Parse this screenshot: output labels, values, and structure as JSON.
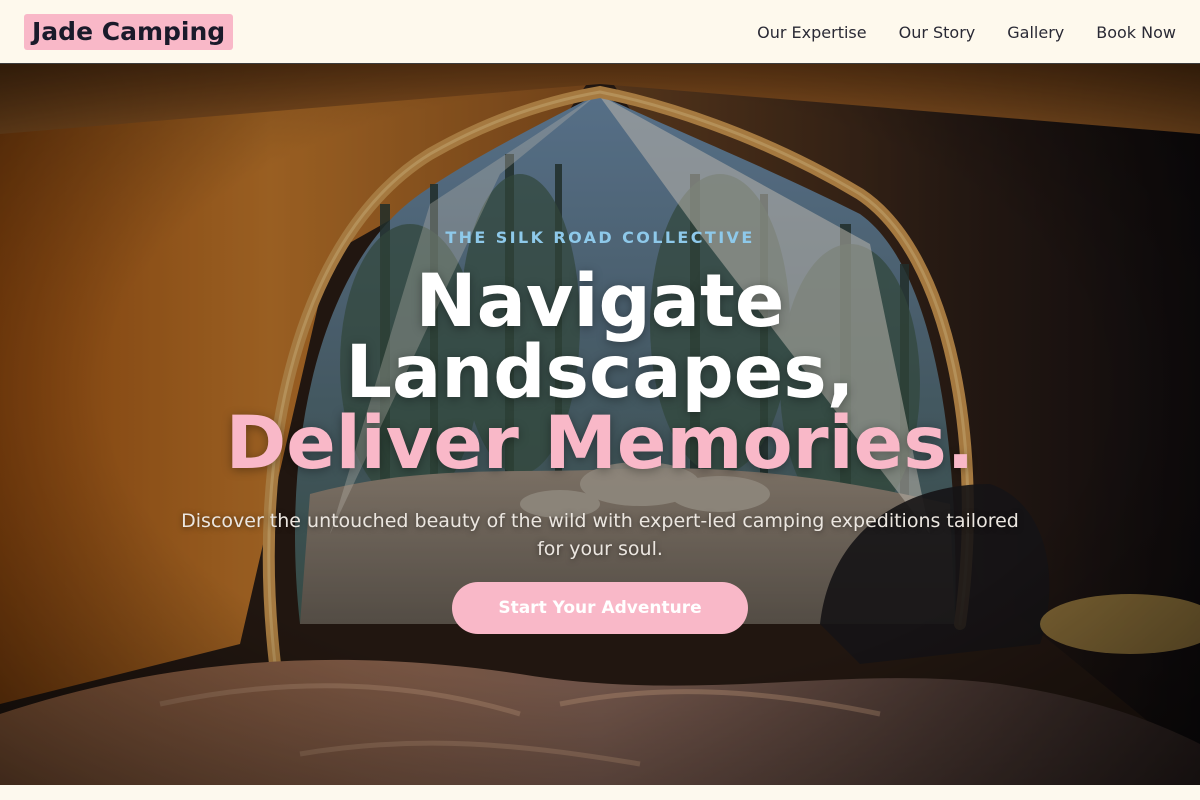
{
  "header": {
    "logo": "Jade Camping",
    "nav": [
      {
        "label": "Our Expertise"
      },
      {
        "label": "Our Story"
      },
      {
        "label": "Gallery"
      },
      {
        "label": "Book Now"
      }
    ]
  },
  "hero": {
    "kicker": "THE SILK ROAD COLLECTIVE",
    "headline_line1": "Navigate",
    "headline_line2": "Landscapes,",
    "headline_line3": "Deliver Memories.",
    "subtitle": "Discover the untouched beauty of the wild with expert-led camping expeditions tailored for your soul.",
    "cta_label": "Start Your Adventure"
  },
  "colors": {
    "accent_pink": "#f9b8c8",
    "kicker_blue": "#8ec9ea",
    "header_bg": "#fef9ed"
  }
}
